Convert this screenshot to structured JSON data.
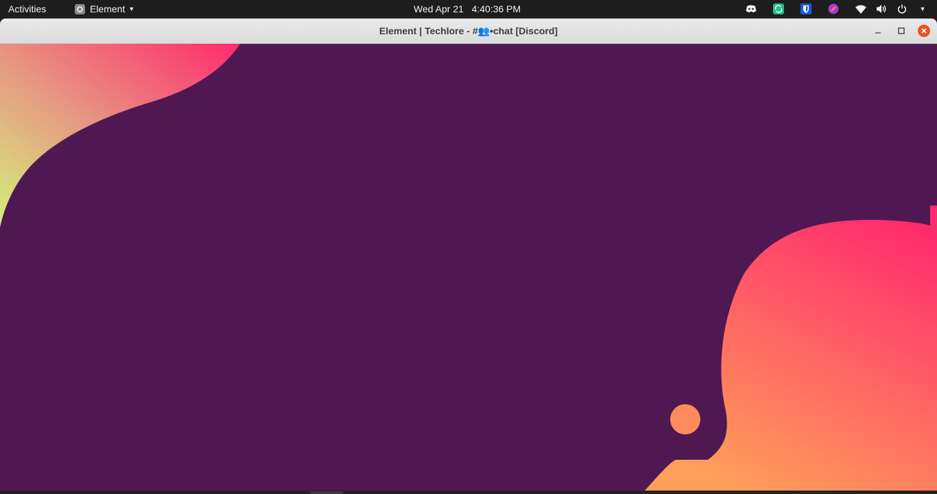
{
  "topbar": {
    "activities_label": "Activities",
    "app_name": "Element",
    "clock": "Wed Apr 21   4:40:36 PM",
    "tray_icons": [
      "discord-icon",
      "sync-icon",
      "bitwarden-icon",
      "color-picker-icon",
      "wifi-icon",
      "volume-icon",
      "power-icon",
      "chevron-down-icon"
    ]
  },
  "window": {
    "title": "Element | Techlore - #👥•chat [Discord]",
    "controls": [
      "minimize",
      "maximize",
      "close"
    ]
  },
  "colors": {
    "background": "#501852",
    "blob_pink": "#ff2a6d",
    "blob_orange": "#ffa05a",
    "blob_lime": "#d4f07a",
    "close_button": "#e95420"
  }
}
